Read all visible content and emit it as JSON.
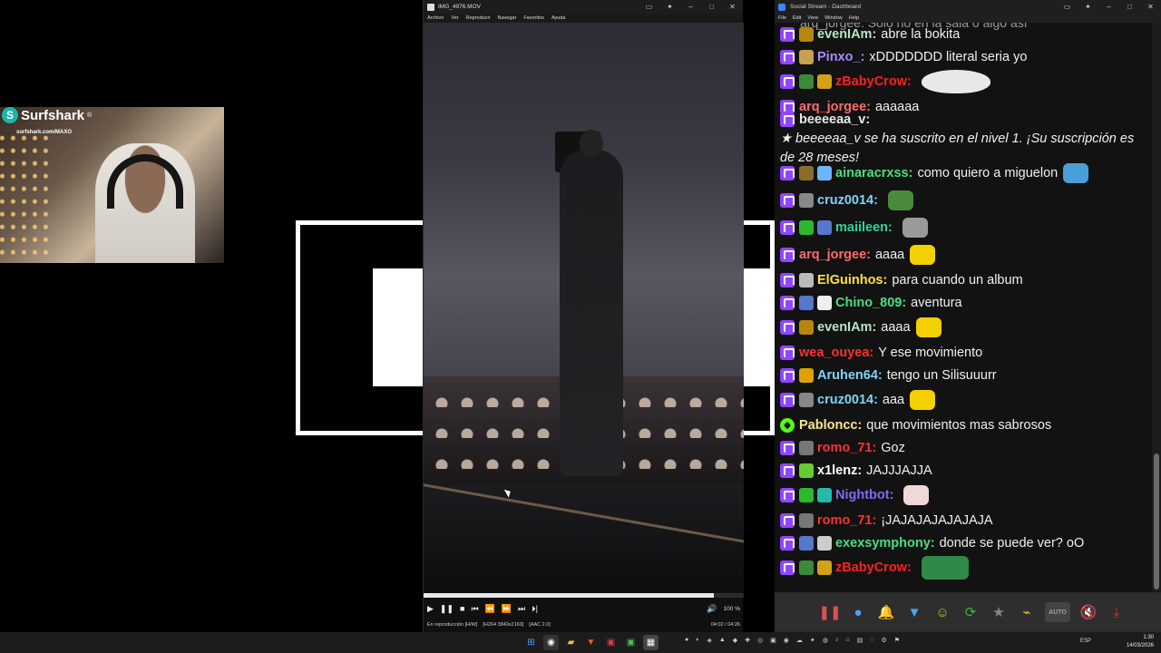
{
  "webcam": {
    "brand": "Surfshark",
    "url": "surfshark.com/MAXO"
  },
  "player": {
    "title": "IMG_4976.MOV",
    "menu": [
      "Archivo",
      "Ver",
      "Reproducir",
      "Navegar",
      "Favoritos",
      "Ayuda"
    ],
    "volume": "100 %",
    "status": "En reproducción [H/W]",
    "codec": "[H264 3840x2160]",
    "audio": "[AAC 2.0]",
    "time": "04:02 / 04:26",
    "progress": 0.906
  },
  "chat": {
    "title": "Social Stream - Dashboard",
    "menu": [
      "File",
      "Edit",
      "View",
      "Window",
      "Help"
    ],
    "top_partial": "arq_jorgee: Solo no en la sala o algo así",
    "messages": [
      {
        "platform": "twitch",
        "badges": [
          "#b8860b"
        ],
        "user": "evenIAm:",
        "color": "#b7e4c7",
        "text": "abre la bokita"
      },
      {
        "platform": "twitch",
        "badges": [
          "#c8a050"
        ],
        "user": "Pinxo_:",
        "color": "#a78bfa",
        "text": "xDDDDDDD literal seria yo"
      },
      {
        "platform": "twitch",
        "badges": [
          "#3a8a3a",
          "#d4a017"
        ],
        "user": "zBabyCrow:",
        "color": "#ff2020",
        "text": "",
        "emote": "#e8e8e8",
        "tall": true
      },
      {
        "platform": "twitch",
        "badges": [],
        "user": "arq_jorgee:",
        "color": "#ff6b6b",
        "text": "aaaaaa"
      },
      {
        "platform": "twitch",
        "badges": [],
        "user": "beeeeaa_v:",
        "color": "#e6e6e6",
        "text": "★ beeeeaa_v se ha suscrito en el nivel 1. ¡Su suscripción es de 28 meses!",
        "italic": true,
        "wrap": true
      },
      {
        "platform": "twitch",
        "badges": [
          "#8b6c2c",
          "#6ab7ff"
        ],
        "user": "ainaracrxss:",
        "color": "#4ade80",
        "text": "como quiero a miguelon",
        "emote": "#4a9fd8"
      },
      {
        "platform": "twitch",
        "badges": [
          "#888888"
        ],
        "user": "cruz0014:",
        "color": "#7dd3fc",
        "text": "",
        "emote": "#4a8a3a"
      },
      {
        "platform": "twitch",
        "badges": [
          "#2eb82e",
          "#5577cc"
        ],
        "user": "maiileen:",
        "color": "#34d399",
        "text": "",
        "emote": "#9a9a9a"
      },
      {
        "platform": "twitch",
        "badges": [],
        "user": "arq_jorgee:",
        "color": "#ff6b6b",
        "text": "aaaa",
        "emote": "#f5d000"
      },
      {
        "platform": "twitch",
        "badges": [
          "#bbbbbb"
        ],
        "user": "ElGuinhos:",
        "color": "#fde047",
        "text": "para cuando un album"
      },
      {
        "platform": "twitch",
        "badges": [
          "#5577cc",
          "#eeeeee"
        ],
        "user": "Chino_809:",
        "color": "#4ade80",
        "text": "aventura"
      },
      {
        "platform": "twitch",
        "badges": [
          "#b8860b"
        ],
        "user": "evenIAm:",
        "color": "#b7e4c7",
        "text": "aaaa",
        "emote": "#f5d000"
      },
      {
        "platform": "twitch",
        "badges": [],
        "user": "wea_ouyea:",
        "color": "#ff3030",
        "text": "Y ese movimiento"
      },
      {
        "platform": "twitch",
        "badges": [
          "#e0a000"
        ],
        "user": "Aruhen64:",
        "color": "#7dd3fc",
        "text": "tengo un Silisuuurr"
      },
      {
        "platform": "twitch",
        "badges": [
          "#888888"
        ],
        "user": "cruz0014:",
        "color": "#7dd3fc",
        "text": "aaa",
        "emote": "#f5d000"
      },
      {
        "platform": "kick",
        "badges": [],
        "user": "Pabloncc:",
        "color": "#fde68a",
        "text": "que movimientos mas sabrosos"
      },
      {
        "platform": "twitch",
        "badges": [
          "#777777"
        ],
        "user": "romo_71:",
        "color": "#ff3030",
        "text": "Goz"
      },
      {
        "platform": "twitch",
        "badges": [
          "#66cc33"
        ],
        "user": "x1lenz:",
        "color": "#ffffff",
        "text": "JAJJJAJJA"
      },
      {
        "platform": "twitch",
        "badges": [
          "#2eb82e",
          "#22bbaa"
        ],
        "user": "Nightbot:",
        "color": "#7c6cf0",
        "text": "",
        "emote": "#f0d8d8"
      },
      {
        "platform": "twitch",
        "badges": [
          "#777777"
        ],
        "user": "romo_71:",
        "color": "#ff3030",
        "text": "¡JAJAJAJAJAJAJA"
      },
      {
        "platform": "twitch",
        "badges": [
          "#5577cc",
          "#cccccc"
        ],
        "user": "exexsymphony:",
        "color": "#4ade80",
        "text": "donde se puede ver? oO"
      },
      {
        "platform": "twitch",
        "badges": [
          "#3a8a3a",
          "#d4a017"
        ],
        "user": "zBabyCrow:",
        "color": "#ff2020",
        "text": "",
        "emote": "#2f8a4a"
      }
    ],
    "toolbar": [
      {
        "name": "pause-icon",
        "glyph": "❚❚",
        "color": "#e05050"
      },
      {
        "name": "chat-bubble-icon",
        "glyph": "●",
        "color": "#4aa3ff"
      },
      {
        "name": "bell-icon",
        "glyph": "🔔",
        "color": "#c8a030"
      },
      {
        "name": "filter-icon",
        "glyph": "▼",
        "color": "#4aa3ff"
      },
      {
        "name": "emoji-icon",
        "glyph": "☺",
        "color": "#d4c030"
      },
      {
        "name": "refresh-icon",
        "glyph": "⟳",
        "color": "#40b040"
      },
      {
        "name": "star-icon",
        "glyph": "★",
        "color": "#888888"
      },
      {
        "name": "broom-icon",
        "glyph": "⌁",
        "color": "#e0c030"
      },
      {
        "name": "auto-icon",
        "glyph": "AUTO",
        "color": "#9aa0aa"
      },
      {
        "name": "mute-icon",
        "glyph": "🔇",
        "color": "#40a080"
      },
      {
        "name": "download-icon",
        "glyph": "⤓",
        "color": "#e03030"
      }
    ]
  },
  "taskbar": {
    "lang": "ESP",
    "time": "1:30",
    "date": "14/03/2026"
  }
}
